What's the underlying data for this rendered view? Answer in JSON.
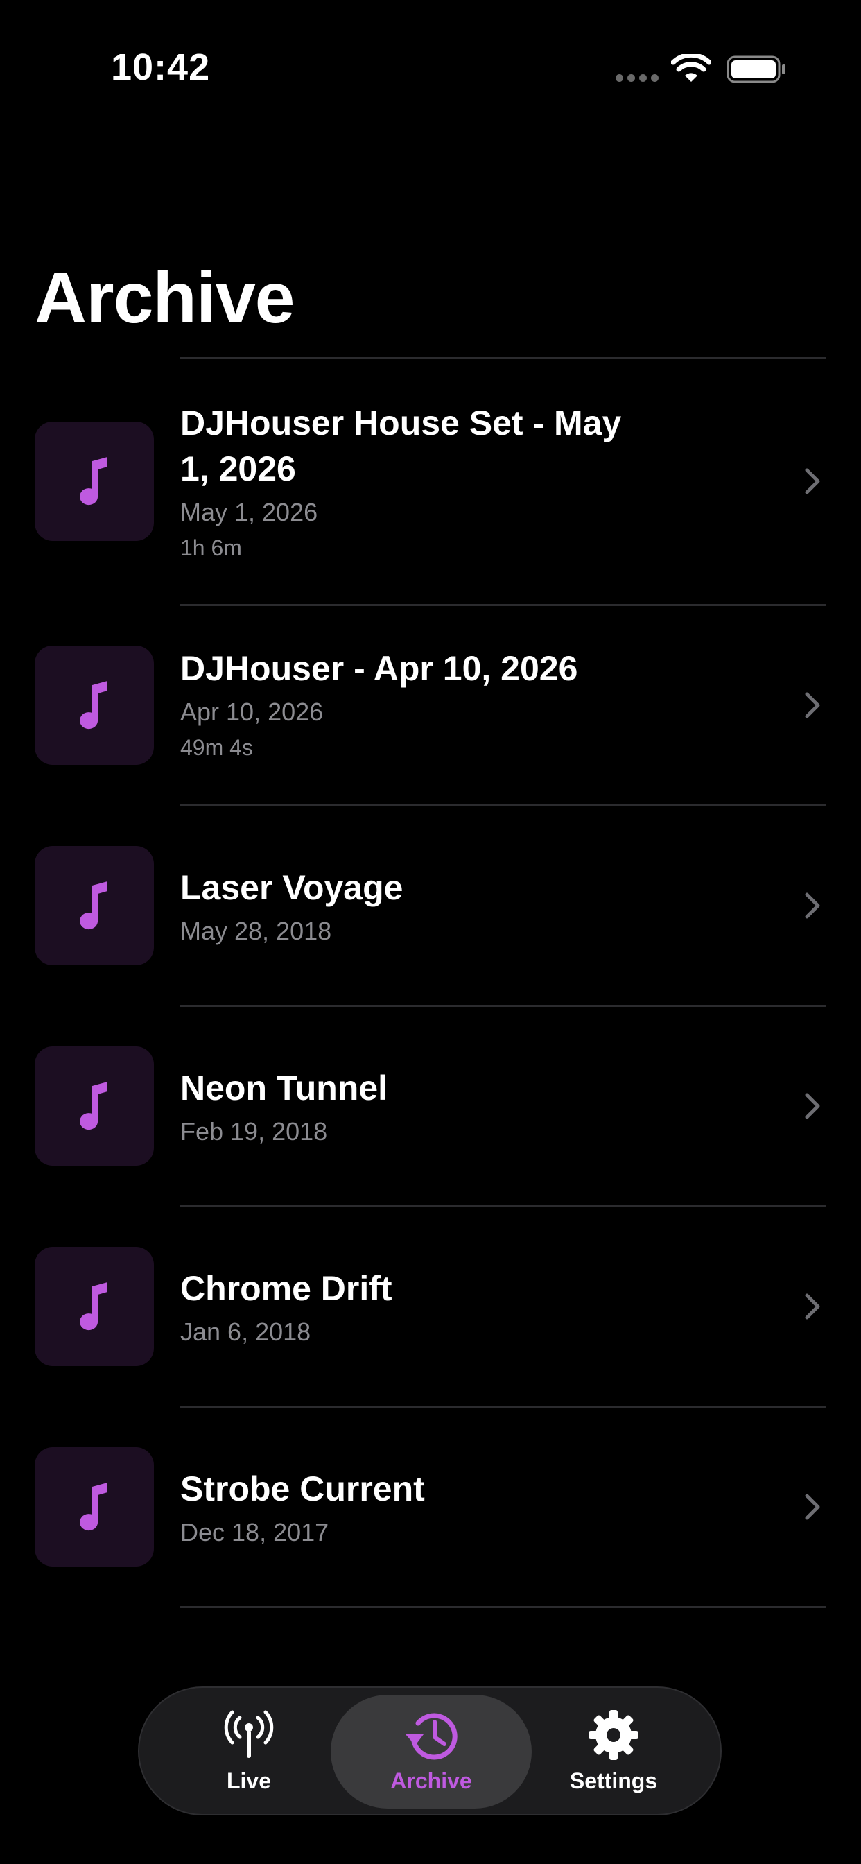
{
  "status_bar": {
    "time": "10:42"
  },
  "colors": {
    "accent": "#bf5ae0",
    "thumb_bg": "#1c0e22",
    "secondary_text": "#8c8c91"
  },
  "page": {
    "title": "Archive"
  },
  "archive_items": [
    {
      "title": "DJHouser House Set - May 1, 2026",
      "date": "May 1, 2026",
      "duration": "1h 6m",
      "icon": "music-note-icon"
    },
    {
      "title": "DJHouser - Apr 10, 2026",
      "date": "Apr 10, 2026",
      "duration": "49m 4s",
      "icon": "music-note-icon"
    },
    {
      "title": "Laser Voyage",
      "date": "May 28, 2018",
      "icon": "music-note-icon"
    },
    {
      "title": "Neon Tunnel",
      "date": "Feb 19, 2018",
      "icon": "music-note-icon"
    },
    {
      "title": "Chrome Drift",
      "date": "Jan 6, 2018",
      "icon": "music-note-icon"
    },
    {
      "title": "Strobe Current",
      "date": "Dec 18, 2017",
      "icon": "music-note-icon"
    }
  ],
  "tab_bar": {
    "tabs": [
      {
        "label": "Live",
        "icon": "antenna-icon",
        "active": false
      },
      {
        "label": "Archive",
        "icon": "history-clock-icon",
        "active": true
      },
      {
        "label": "Settings",
        "icon": "gear-icon",
        "active": false
      }
    ]
  }
}
